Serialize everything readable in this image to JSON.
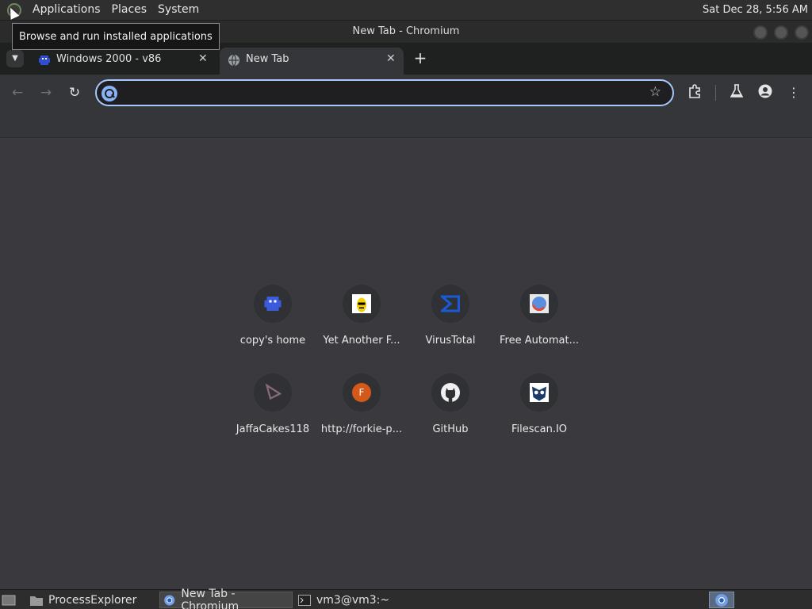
{
  "top_panel": {
    "menus": [
      "Applications",
      "Places",
      "System"
    ],
    "clock": "Sat Dec 28,  5:56 AM",
    "tooltip": "Browse and run installed applications"
  },
  "window": {
    "title": "New Tab - Chromium"
  },
  "tabs": [
    {
      "label": "Windows 2000 - v86",
      "icon": "pixel-invader-icon",
      "active": false
    },
    {
      "label": "New Tab",
      "icon": "globe-icon",
      "active": true
    }
  ],
  "toolbar": {
    "omnibox_value": "",
    "omnibox_placeholder": ""
  },
  "shortcuts": [
    {
      "label": "copy's home",
      "icon": "pixel-invader-icon",
      "color": "#3b5bdb"
    },
    {
      "label": "Yet Another F...",
      "icon": "banana-icon",
      "color": "#f5d000"
    },
    {
      "label": "VirusTotal",
      "icon": "sigma-icon",
      "color": "#1a5ad7"
    },
    {
      "label": "Free Automat...",
      "icon": "sphere-icon",
      "color": "#5a8fe0"
    },
    {
      "label": "JaffaCakes118",
      "icon": "play-triangle-icon",
      "color": "#7a5a6a"
    },
    {
      "label": "http://forkie-p...",
      "icon": "letter-f-icon",
      "letter": "F",
      "color": "#d4581a"
    },
    {
      "label": "GitHub",
      "icon": "github-icon",
      "color": "#f0f0f0"
    },
    {
      "label": "Filescan.IO",
      "icon": "owl-icon",
      "color": "#1a3a6a"
    }
  ],
  "taskbar": {
    "items": [
      {
        "label": "ProcessExplorer",
        "icon": "folder-icon",
        "active": false
      },
      {
        "label": "New Tab - Chromium",
        "icon": "chromium-icon",
        "active": true
      },
      {
        "label": "vm3@vm3:~",
        "icon": "terminal-icon",
        "active": false
      }
    ]
  }
}
